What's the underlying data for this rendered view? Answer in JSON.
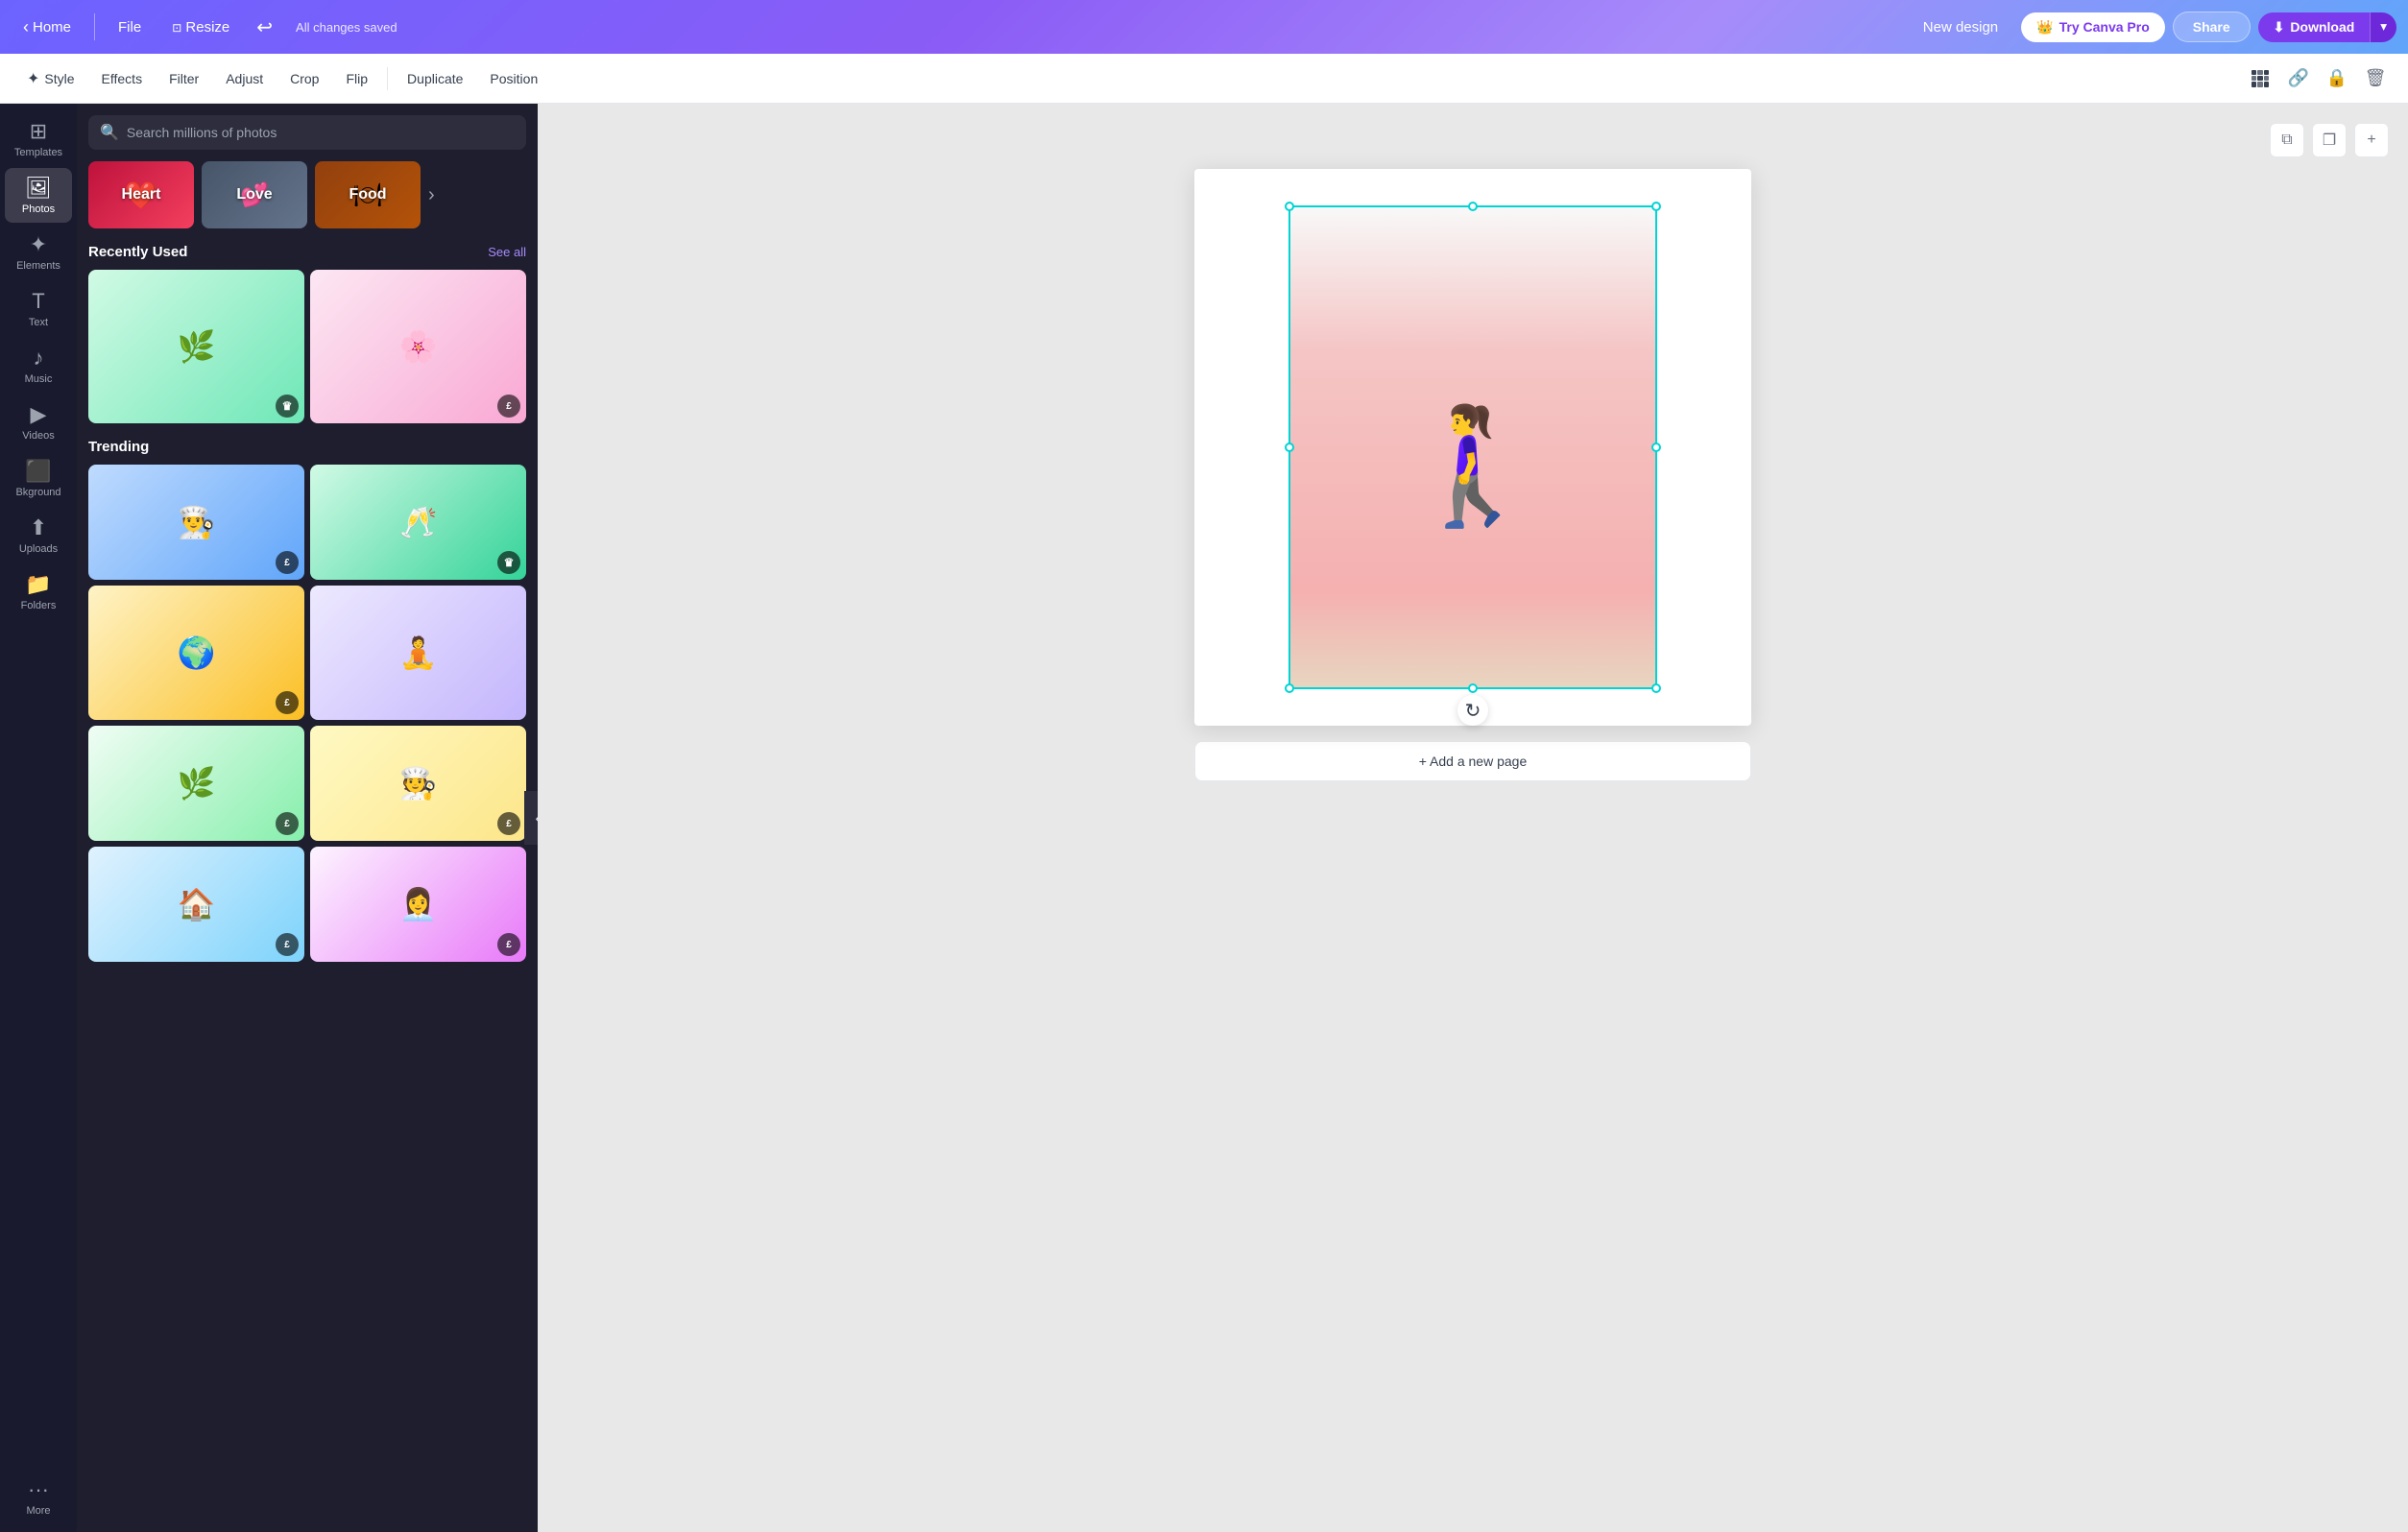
{
  "topbar": {
    "home_label": "Home",
    "file_label": "File",
    "resize_label": "Resize",
    "saved_label": "All changes saved",
    "new_design_label": "New design",
    "try_pro_label": "Try Canva Pro",
    "share_label": "Share",
    "download_label": "Download"
  },
  "toolbar2": {
    "style_label": "Style",
    "effects_label": "Effects",
    "filter_label": "Filter",
    "adjust_label": "Adjust",
    "crop_label": "Crop",
    "flip_label": "Flip",
    "duplicate_label": "Duplicate",
    "position_label": "Position"
  },
  "sidebar": {
    "items": [
      {
        "id": "templates",
        "label": "Templates",
        "icon": "⊞"
      },
      {
        "id": "photos",
        "label": "Photos",
        "icon": "🖼"
      },
      {
        "id": "elements",
        "label": "Elements",
        "icon": "✦"
      },
      {
        "id": "text",
        "label": "Text",
        "icon": "T"
      },
      {
        "id": "music",
        "label": "Music",
        "icon": "♪"
      },
      {
        "id": "videos",
        "label": "Videos",
        "icon": "▶"
      },
      {
        "id": "background",
        "label": "Bkground",
        "icon": "⬛"
      },
      {
        "id": "uploads",
        "label": "Uploads",
        "icon": "⬆"
      },
      {
        "id": "folders",
        "label": "Folders",
        "icon": "📁"
      },
      {
        "id": "more",
        "label": "More",
        "icon": "···"
      }
    ]
  },
  "photos_panel": {
    "search_placeholder": "Search millions of photos",
    "categories": [
      {
        "label": "Heart",
        "bg": "heart"
      },
      {
        "label": "Love",
        "bg": "love"
      },
      {
        "label": "Food",
        "bg": "food"
      }
    ],
    "recently_used_label": "Recently Used",
    "see_all_label": "See all",
    "trending_label": "Trending"
  },
  "canvas": {
    "add_page_label": "+ Add a new page"
  }
}
